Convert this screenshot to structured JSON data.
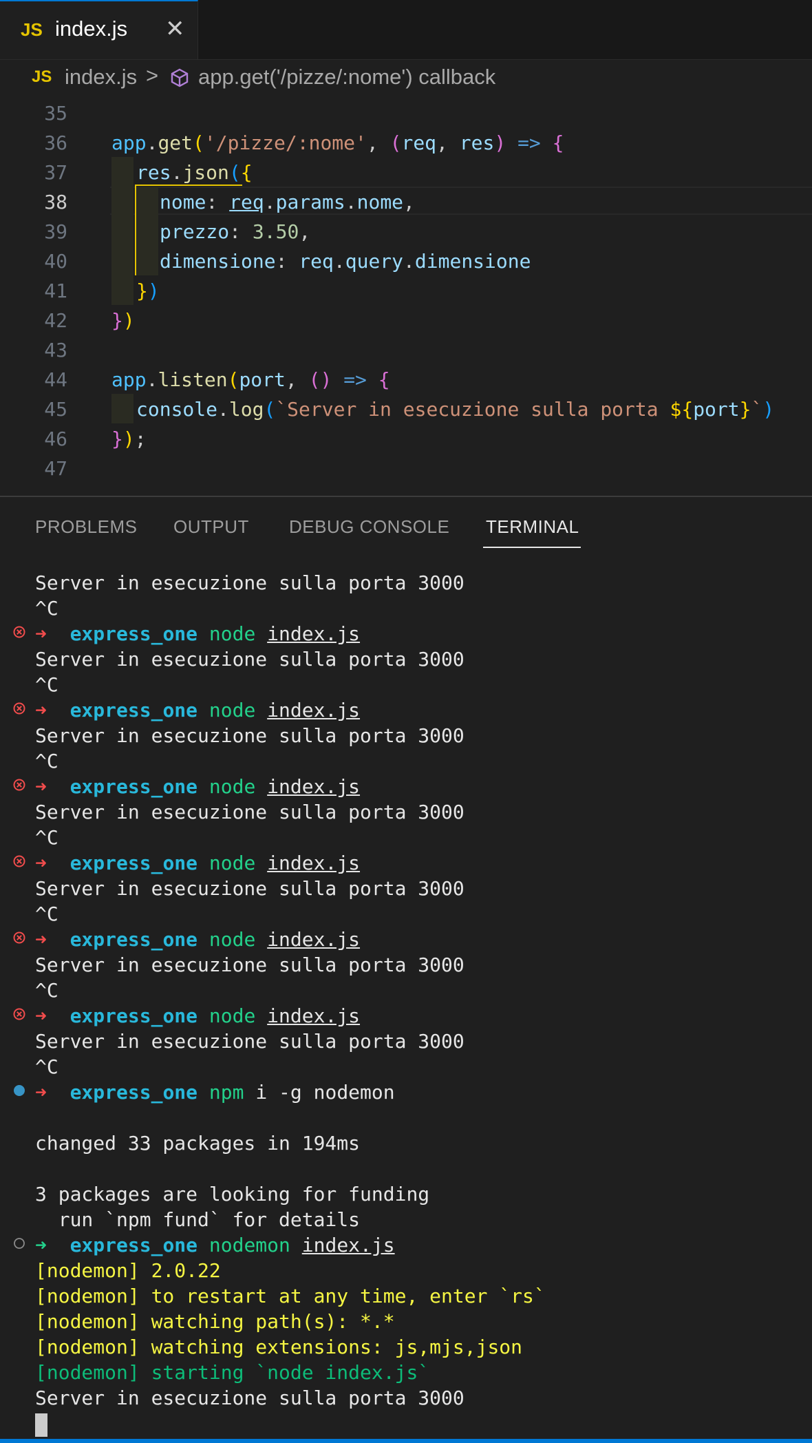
{
  "tab": {
    "icon": "JS",
    "filename": "index.js",
    "close": "✕"
  },
  "breadcrumb": {
    "icon": "JS",
    "file": "index.js",
    "separator": ">",
    "symbol": "app.get('/pizze/:nome') callback"
  },
  "editor": {
    "line_numbers": [
      "35",
      "36",
      "37",
      "38",
      "39",
      "40",
      "41",
      "42",
      "43",
      "44",
      "45",
      "46",
      "47"
    ],
    "active_line": "38"
  },
  "panel": {
    "tabs": [
      "PROBLEMS",
      "OUTPUT",
      "DEBUG CONSOLE",
      "TERMINAL"
    ],
    "active_tab": "TERMINAL"
  },
  "terminal": {
    "server_msg": "Server in esecuzione sulla porta 3000",
    "ctrl_c": "^C",
    "prompt_arrow": "➜",
    "dir": "express_one",
    "node_cmd": "node",
    "file_arg": "index.js",
    "npm_cmd": "npm",
    "npm_args": "i -g nodemon",
    "changed": "changed 33 packages in 194ms",
    "funding1": "3 packages are looking for funding",
    "funding2": "  run `npm fund` for details",
    "nodemon_cmd": "nodemon",
    "nodemon_version": "[nodemon] 2.0.22",
    "nodemon_restart": "[nodemon] to restart at any time, enter `rs`",
    "nodemon_watch_paths": "[nodemon] watching path(s): *.*",
    "nodemon_watch_ext": "[nodemon] watching extensions: js,mjs,json",
    "nodemon_starting": "[nodemon] starting `node index.js`"
  },
  "colors": {
    "accent": "#0078d4",
    "error": "#f14c4c",
    "success": "#23d18b",
    "dir": "#29b8db",
    "nodemon": "#f5f543"
  }
}
